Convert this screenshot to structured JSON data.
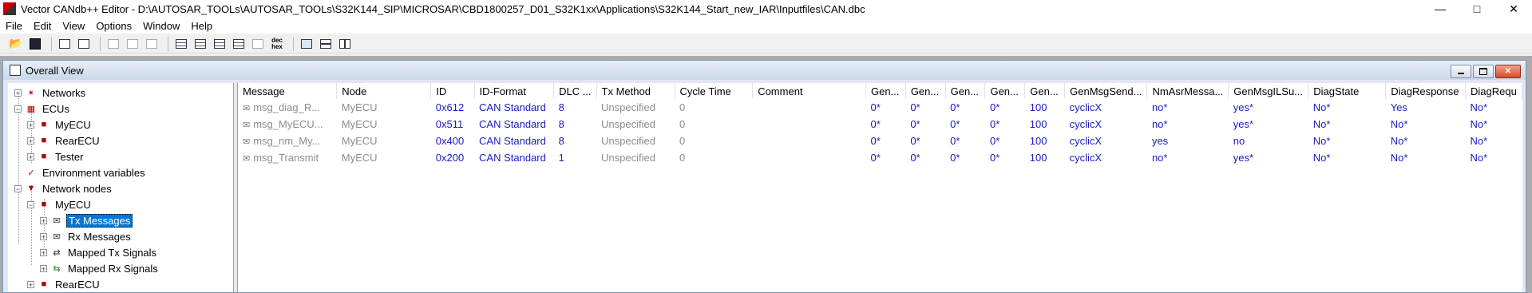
{
  "window": {
    "title": "Vector CANdb++ Editor - D:\\AUTOSAR_TOOLs\\AUTOSAR_TOOLs\\S32K144_SIP\\MICROSAR\\CBD1800257_D01_S32K1xx\\Applications\\S32K144_Start_new_IAR\\Inputfiles\\CAN.dbc",
    "controls": {
      "minimize": "—",
      "maximize": "□",
      "close": "✕"
    }
  },
  "menu": [
    "File",
    "Edit",
    "View",
    "Options",
    "Window",
    "Help"
  ],
  "toolbar": {
    "dechex_top": "dec",
    "dechex_bottom": "hex"
  },
  "child_window": {
    "title": "Overall View"
  },
  "tree": {
    "networks": "Networks",
    "ecus": "ECUs",
    "ecu_myecu": "MyECU",
    "ecu_rearecu": "RearECU",
    "ecu_tester": "Tester",
    "env_vars": "Environment variables",
    "network_nodes": "Network nodes",
    "node_myecu": "MyECU",
    "tx_messages": "Tx Messages",
    "rx_messages": "Rx Messages",
    "mapped_tx": "Mapped Tx Signals",
    "mapped_rx": "Mapped Rx Signals",
    "node_rearecu": "RearECU"
  },
  "table": {
    "columns": [
      "Message",
      "Node",
      "ID",
      "ID-Format",
      "DLC ...",
      "Tx Method",
      "Cycle Time",
      "Comment",
      "Gen...",
      "Gen...",
      "Gen...",
      "Gen...",
      "Gen...",
      "GenMsgSend...",
      "NmAsrMessa...",
      "GenMsgILSu...",
      "DiagState",
      "DiagResponse",
      "DiagRequ"
    ],
    "rows": [
      [
        "msg_diag_R...",
        "MyECU",
        "0x612",
        "CAN Standard",
        "8",
        "Unspecified",
        "0",
        "",
        "0*",
        "0*",
        "0*",
        "0*",
        "100",
        "cyclicX",
        "no*",
        "yes*",
        "No*",
        "Yes",
        "No*"
      ],
      [
        "msg_MyECU...",
        "MyECU",
        "0x511",
        "CAN Standard",
        "8",
        "Unspecified",
        "0",
        "",
        "0*",
        "0*",
        "0*",
        "0*",
        "100",
        "cyclicX",
        "no*",
        "yes*",
        "No*",
        "No*",
        "No*"
      ],
      [
        "msg_nm_My...",
        "MyECU",
        "0x400",
        "CAN Standard",
        "8",
        "Unspecified",
        "0",
        "",
        "0*",
        "0*",
        "0*",
        "0*",
        "100",
        "cyclicX",
        "yes",
        "no",
        "No*",
        "No*",
        "No*"
      ],
      [
        "msg_Transmit",
        "MyECU",
        "0x200",
        "CAN Standard",
        "1",
        "Unspecified",
        "0",
        "",
        "0*",
        "0*",
        "0*",
        "0*",
        "100",
        "cyclicX",
        "no*",
        "yes*",
        "No*",
        "No*",
        "No*"
      ]
    ]
  },
  "colors": {
    "selection": "#0078d7",
    "value_blue": "#1a1ac8",
    "inherited_gray": "#8c8c8c",
    "mdi_background": "#ababab"
  }
}
